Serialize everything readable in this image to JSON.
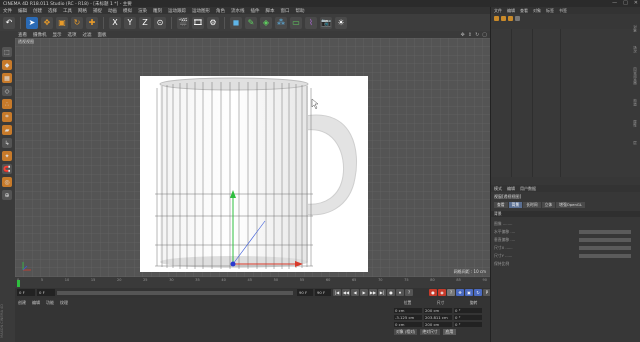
{
  "window": {
    "title": "CINEMA 4D R18.011 Studio (RC - R18) - [未标题 1 *] - 主要",
    "controls": [
      "—",
      "□",
      "✕"
    ]
  },
  "menubar": {
    "items": [
      "文件",
      "编辑",
      "创建",
      "选择",
      "工具",
      "网格",
      "捕捉",
      "动画",
      "模拟",
      "渲染",
      "雕刻",
      "运动跟踪",
      "运动图形",
      "角色",
      "流水线",
      "插件",
      "脚本",
      "窗口",
      "帮助"
    ],
    "right_label": "界面:"
  },
  "viewport": {
    "menu": [
      "查看",
      "摄像机",
      "显示",
      "选项",
      "过滤",
      "面板"
    ],
    "label": "透视视图",
    "grid_info": "网格间距 : 10 cm"
  },
  "timeline": {
    "ticks": [
      "0",
      "5",
      "10",
      "15",
      "20",
      "25",
      "30",
      "35",
      "40",
      "45",
      "50",
      "55",
      "60",
      "65",
      "70",
      "75",
      "80",
      "85",
      "90"
    ],
    "current_frame": "0 F",
    "start_frame": "0 F",
    "end_frame": "90 F",
    "max_frame": "90 F",
    "transport_icons": [
      "|◀",
      "◀◀",
      "◀",
      "▶",
      "▶▶",
      "▶|",
      "●",
      "⏺",
      "?"
    ]
  },
  "material_panel": {
    "menu": [
      "创建",
      "编辑",
      "功能",
      "纹理"
    ]
  },
  "coordinates": {
    "headers": [
      "位置",
      "尺寸",
      "旋转"
    ],
    "rows": [
      {
        "pos_label": "X",
        "pos": "0 cm",
        "size_label": "X",
        "size": "200 cm",
        "rot_label": "H",
        "rot": "0 °"
      },
      {
        "pos_label": "Y",
        "pos": "-3.125 cm",
        "size_label": "Y",
        "size": "203.811 cm",
        "rot_label": "P",
        "rot": "0 °"
      },
      {
        "pos_label": "Z",
        "pos": "0 cm",
        "size_label": "Z",
        "size": "200 cm",
        "rot_label": "B",
        "rot": "0 °"
      }
    ],
    "mode": "对象 (相对)",
    "size_mode": "绝对尺寸",
    "apply": "应用"
  },
  "object_manager": {
    "menu": [
      "文件",
      "编辑",
      "查看",
      "对象",
      "标签",
      "书签"
    ]
  },
  "attributes": {
    "menu": [
      "模式",
      "编辑",
      "用户数据"
    ],
    "title": "视窗[透视视图]",
    "tabs": [
      "查看",
      "背景",
      "长时间",
      "立体",
      "增强OpenGL"
    ],
    "active_tab": 1,
    "section": "背景",
    "rows": [
      "图像 ........",
      "水平偏移 ....",
      "垂直偏移 ....",
      "尺寸X ......",
      "尺寸Y ......",
      "保持比例"
    ]
  },
  "side_tabs": [
    "对象",
    "场次",
    "内容浏览器",
    "构造",
    "属性",
    "层"
  ],
  "brand": "MAXON CINEMA 4D"
}
